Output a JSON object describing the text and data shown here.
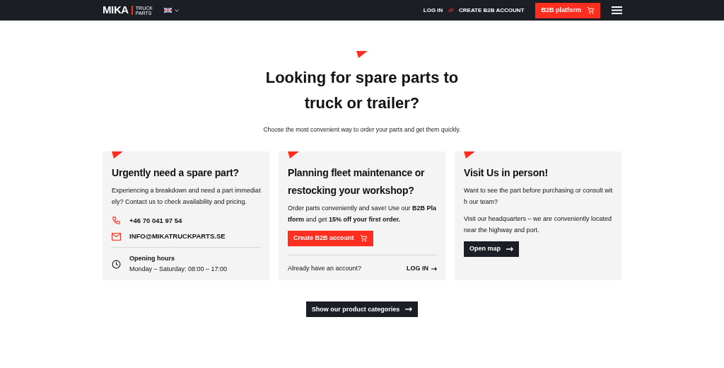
{
  "header": {
    "logo": {
      "word": "MIKA",
      "sub_top": "TRUCK",
      "sub_bottom": "PARTS"
    },
    "nav": [
      "LOG IN",
      "CREATE B2B ACCOUNT"
    ],
    "separator": "///",
    "b2b_button": "B2B platform"
  },
  "hero": {
    "title_lines": [
      "Looking for spare parts to",
      "truck or trailer?"
    ],
    "subtitle": "Choose the most convenient way to order your parts and get them quickly."
  },
  "cards": [
    {
      "kind": "contact",
      "title": "Urgently need a spare part?",
      "text": "Experiencing a breakdown and need a part immediately? Contact us to check availability and pricing.",
      "phone": "+46 70 041 97 54",
      "email": "INFO@MIKATRUCKPARTS.SE",
      "hours_label": "Opening hours",
      "hours": "Monday – Saturday: 08:00 – 17:00"
    },
    {
      "kind": "b2b",
      "title": "Planning fleet maintenance or restocking your workshop?",
      "text": "Order parts conveniently and save! Use our **B2B Platform** and get **15% off your first order.**",
      "button": "Create B2B account",
      "login_prompt": "Already have an account?",
      "login_link": "LOG IN"
    },
    {
      "kind": "visit",
      "title": "Visit Us in person!",
      "paragraphs": [
        "Want to see the part before purchasing or consult with our team?",
        "Visit our headquarters – we are conveniently located near the highway and port."
      ],
      "button": "Open map"
    }
  ],
  "categories_button": "Show our product categories"
}
